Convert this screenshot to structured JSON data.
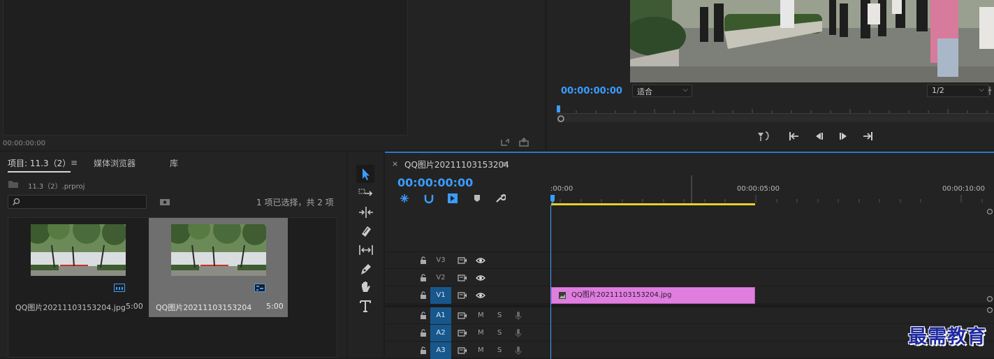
{
  "source_monitor": {
    "timecode": "00:00:00:00"
  },
  "program_monitor": {
    "timecode": "00:00:00:00",
    "zoom": "适合",
    "resolution": "1/2"
  },
  "project_panel": {
    "tabs": [
      "项目: 11.3（2）",
      "媒体浏览器",
      "库"
    ],
    "file_name": "11.3（2）.prproj",
    "search_placeholder": "",
    "selection_status": "1 项已选择，共 2 项",
    "items": [
      {
        "name": "QQ图片20211103153204.jpg",
        "duration": "5:00",
        "selected": false
      },
      {
        "name": "QQ图片20211103153204",
        "duration": "5:00",
        "selected": true
      }
    ]
  },
  "timeline": {
    "sequence_name": "QQ图片20211103153204",
    "timecode": "00:00:00:00",
    "ruler_labels": [
      ":00:00",
      "00:00:05:00",
      "00:00:10:00"
    ],
    "video_tracks": [
      "V3",
      "V2",
      "V1"
    ],
    "audio_tracks": [
      "A1",
      "A2",
      "A3"
    ],
    "mute_label": "M",
    "solo_label": "S",
    "clip_name": "QQ图片20211103153204.jpg",
    "accent_color": "#3b9cff",
    "clip_color": "#e07ee0"
  },
  "tools": [
    "selection-tool",
    "track-select-tool",
    "ripple-edit-tool",
    "razor-tool",
    "slip-tool",
    "pen-tool",
    "hand-tool",
    "type-tool"
  ],
  "watermark": "最需教育"
}
